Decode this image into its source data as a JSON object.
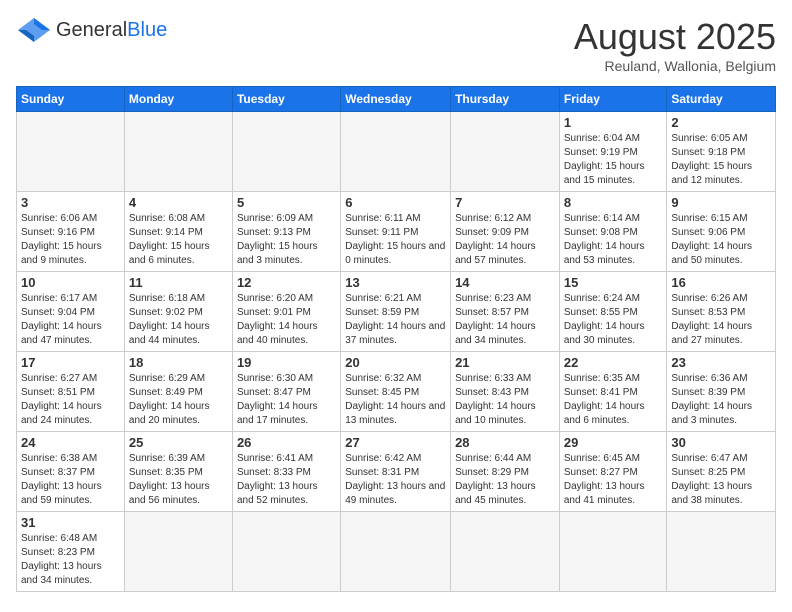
{
  "header": {
    "logo_general": "General",
    "logo_blue": "Blue",
    "month_title": "August 2025",
    "subtitle": "Reuland, Wallonia, Belgium"
  },
  "weekdays": [
    "Sunday",
    "Monday",
    "Tuesday",
    "Wednesday",
    "Thursday",
    "Friday",
    "Saturday"
  ],
  "weeks": [
    [
      {
        "day": "",
        "info": "",
        "empty": true
      },
      {
        "day": "",
        "info": "",
        "empty": true
      },
      {
        "day": "",
        "info": "",
        "empty": true
      },
      {
        "day": "",
        "info": "",
        "empty": true
      },
      {
        "day": "",
        "info": "",
        "empty": true
      },
      {
        "day": "1",
        "info": "Sunrise: 6:04 AM\nSunset: 9:19 PM\nDaylight: 15 hours and 15 minutes."
      },
      {
        "day": "2",
        "info": "Sunrise: 6:05 AM\nSunset: 9:18 PM\nDaylight: 15 hours and 12 minutes."
      }
    ],
    [
      {
        "day": "3",
        "info": "Sunrise: 6:06 AM\nSunset: 9:16 PM\nDaylight: 15 hours and 9 minutes."
      },
      {
        "day": "4",
        "info": "Sunrise: 6:08 AM\nSunset: 9:14 PM\nDaylight: 15 hours and 6 minutes."
      },
      {
        "day": "5",
        "info": "Sunrise: 6:09 AM\nSunset: 9:13 PM\nDaylight: 15 hours and 3 minutes."
      },
      {
        "day": "6",
        "info": "Sunrise: 6:11 AM\nSunset: 9:11 PM\nDaylight: 15 hours and 0 minutes."
      },
      {
        "day": "7",
        "info": "Sunrise: 6:12 AM\nSunset: 9:09 PM\nDaylight: 14 hours and 57 minutes."
      },
      {
        "day": "8",
        "info": "Sunrise: 6:14 AM\nSunset: 9:08 PM\nDaylight: 14 hours and 53 minutes."
      },
      {
        "day": "9",
        "info": "Sunrise: 6:15 AM\nSunset: 9:06 PM\nDaylight: 14 hours and 50 minutes."
      }
    ],
    [
      {
        "day": "10",
        "info": "Sunrise: 6:17 AM\nSunset: 9:04 PM\nDaylight: 14 hours and 47 minutes."
      },
      {
        "day": "11",
        "info": "Sunrise: 6:18 AM\nSunset: 9:02 PM\nDaylight: 14 hours and 44 minutes."
      },
      {
        "day": "12",
        "info": "Sunrise: 6:20 AM\nSunset: 9:01 PM\nDaylight: 14 hours and 40 minutes."
      },
      {
        "day": "13",
        "info": "Sunrise: 6:21 AM\nSunset: 8:59 PM\nDaylight: 14 hours and 37 minutes."
      },
      {
        "day": "14",
        "info": "Sunrise: 6:23 AM\nSunset: 8:57 PM\nDaylight: 14 hours and 34 minutes."
      },
      {
        "day": "15",
        "info": "Sunrise: 6:24 AM\nSunset: 8:55 PM\nDaylight: 14 hours and 30 minutes."
      },
      {
        "day": "16",
        "info": "Sunrise: 6:26 AM\nSunset: 8:53 PM\nDaylight: 14 hours and 27 minutes."
      }
    ],
    [
      {
        "day": "17",
        "info": "Sunrise: 6:27 AM\nSunset: 8:51 PM\nDaylight: 14 hours and 24 minutes."
      },
      {
        "day": "18",
        "info": "Sunrise: 6:29 AM\nSunset: 8:49 PM\nDaylight: 14 hours and 20 minutes."
      },
      {
        "day": "19",
        "info": "Sunrise: 6:30 AM\nSunset: 8:47 PM\nDaylight: 14 hours and 17 minutes."
      },
      {
        "day": "20",
        "info": "Sunrise: 6:32 AM\nSunset: 8:45 PM\nDaylight: 14 hours and 13 minutes."
      },
      {
        "day": "21",
        "info": "Sunrise: 6:33 AM\nSunset: 8:43 PM\nDaylight: 14 hours and 10 minutes."
      },
      {
        "day": "22",
        "info": "Sunrise: 6:35 AM\nSunset: 8:41 PM\nDaylight: 14 hours and 6 minutes."
      },
      {
        "day": "23",
        "info": "Sunrise: 6:36 AM\nSunset: 8:39 PM\nDaylight: 14 hours and 3 minutes."
      }
    ],
    [
      {
        "day": "24",
        "info": "Sunrise: 6:38 AM\nSunset: 8:37 PM\nDaylight: 13 hours and 59 minutes."
      },
      {
        "day": "25",
        "info": "Sunrise: 6:39 AM\nSunset: 8:35 PM\nDaylight: 13 hours and 56 minutes."
      },
      {
        "day": "26",
        "info": "Sunrise: 6:41 AM\nSunset: 8:33 PM\nDaylight: 13 hours and 52 minutes."
      },
      {
        "day": "27",
        "info": "Sunrise: 6:42 AM\nSunset: 8:31 PM\nDaylight: 13 hours and 49 minutes."
      },
      {
        "day": "28",
        "info": "Sunrise: 6:44 AM\nSunset: 8:29 PM\nDaylight: 13 hours and 45 minutes."
      },
      {
        "day": "29",
        "info": "Sunrise: 6:45 AM\nSunset: 8:27 PM\nDaylight: 13 hours and 41 minutes."
      },
      {
        "day": "30",
        "info": "Sunrise: 6:47 AM\nSunset: 8:25 PM\nDaylight: 13 hours and 38 minutes."
      }
    ],
    [
      {
        "day": "31",
        "info": "Sunrise: 6:48 AM\nSunset: 8:23 PM\nDaylight: 13 hours and 34 minutes.",
        "last": true
      },
      {
        "day": "",
        "info": "",
        "empty": true,
        "last": true
      },
      {
        "day": "",
        "info": "",
        "empty": true,
        "last": true
      },
      {
        "day": "",
        "info": "",
        "empty": true,
        "last": true
      },
      {
        "day": "",
        "info": "",
        "empty": true,
        "last": true
      },
      {
        "day": "",
        "info": "",
        "empty": true,
        "last": true
      },
      {
        "day": "",
        "info": "",
        "empty": true,
        "last": true
      }
    ]
  ]
}
